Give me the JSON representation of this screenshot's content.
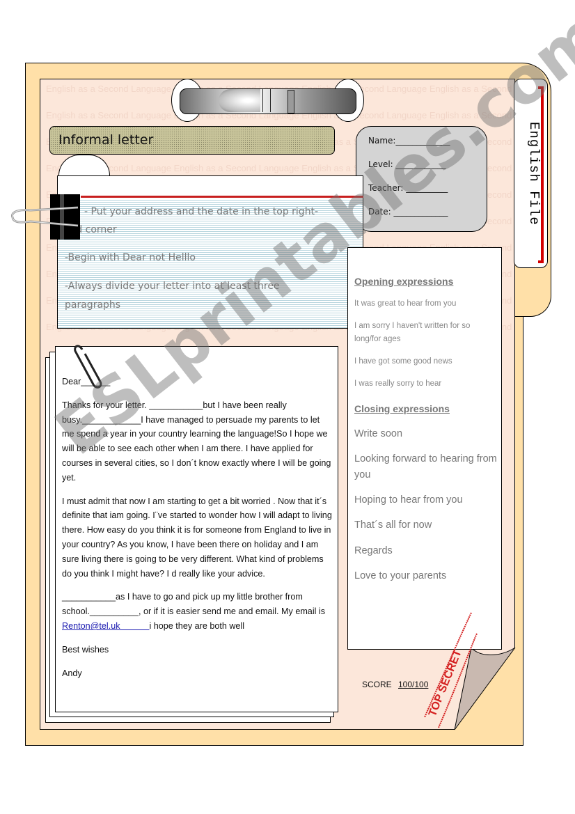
{
  "document": {
    "title": "Informal letter",
    "tab_label": "English File",
    "background_text": "English as a Second Language",
    "colors": {
      "folder": "#FFE0A8",
      "sheet": "#FCE7DA",
      "accent_red": "#C81E1E",
      "title_bar": "#C8C49A",
      "info_box": "#D4D4D4",
      "link_blue": "#1A1AB0"
    }
  },
  "student_info": {
    "name": "Name:_____________",
    "level": "Level: ____________",
    "teacher": "Teacher: __________",
    "date": "Date: _____________"
  },
  "tips": [
    "- Put your address and the date in the top right-",
    "hand corner",
    "-Begin with Dear not Helllo",
    "-Always divide your letter into at least three",
    "paragraphs"
  ],
  "expressions": {
    "opening_heading": "Opening expressions",
    "opening": [
      "It was great to hear from you",
      "I am sorry I haven't written for so long/for ages",
      "I have got some good news",
      "I was really sorry to hear"
    ],
    "closing_heading": "Closing expressions",
    "closing": [
      "Write soon",
      "Looking forward to hearing from you",
      "Hoping to hear from you",
      "That´s all for now",
      "Regards",
      "Love to your parents"
    ]
  },
  "letter": {
    "greeting": "Dear______",
    "paragraph1": "Thanks for your letter.  ___________but I have been really busy.____________I have managed to persuade my parents to let me spend a year in your country learning the language!So I hope we will be able to see each other when I am there. I have applied for courses in several cities, so I don´t know exactly where I will be going yet.",
    "paragraph2": "I must admit that now I am starting to get a bit worried . Now that it´s definite that iam going. I¨ve started to wonder how I will adapt to living there. How easy do you think it is for someone from England to live in your country? As you know, I have been there on holiday and I am sure living there is going to be very different. What kind of problems do you think I might have? I d really like your advice.",
    "paragraph3_start": "___________as I have to go and pick up my little brother from school.__________, or if it is easier send me and email. My email is ",
    "email": "Renton@tel.uk",
    "email_pad": "            ",
    "paragraph3_end": "i hope they are both well",
    "sign_off": "Best wishes",
    "signature": "Andy"
  },
  "score": {
    "label": "SCORE",
    "value": "100/100"
  },
  "stamp": {
    "text": "TOP SECRET"
  },
  "watermark": {
    "text": "ESLprintables.com"
  }
}
